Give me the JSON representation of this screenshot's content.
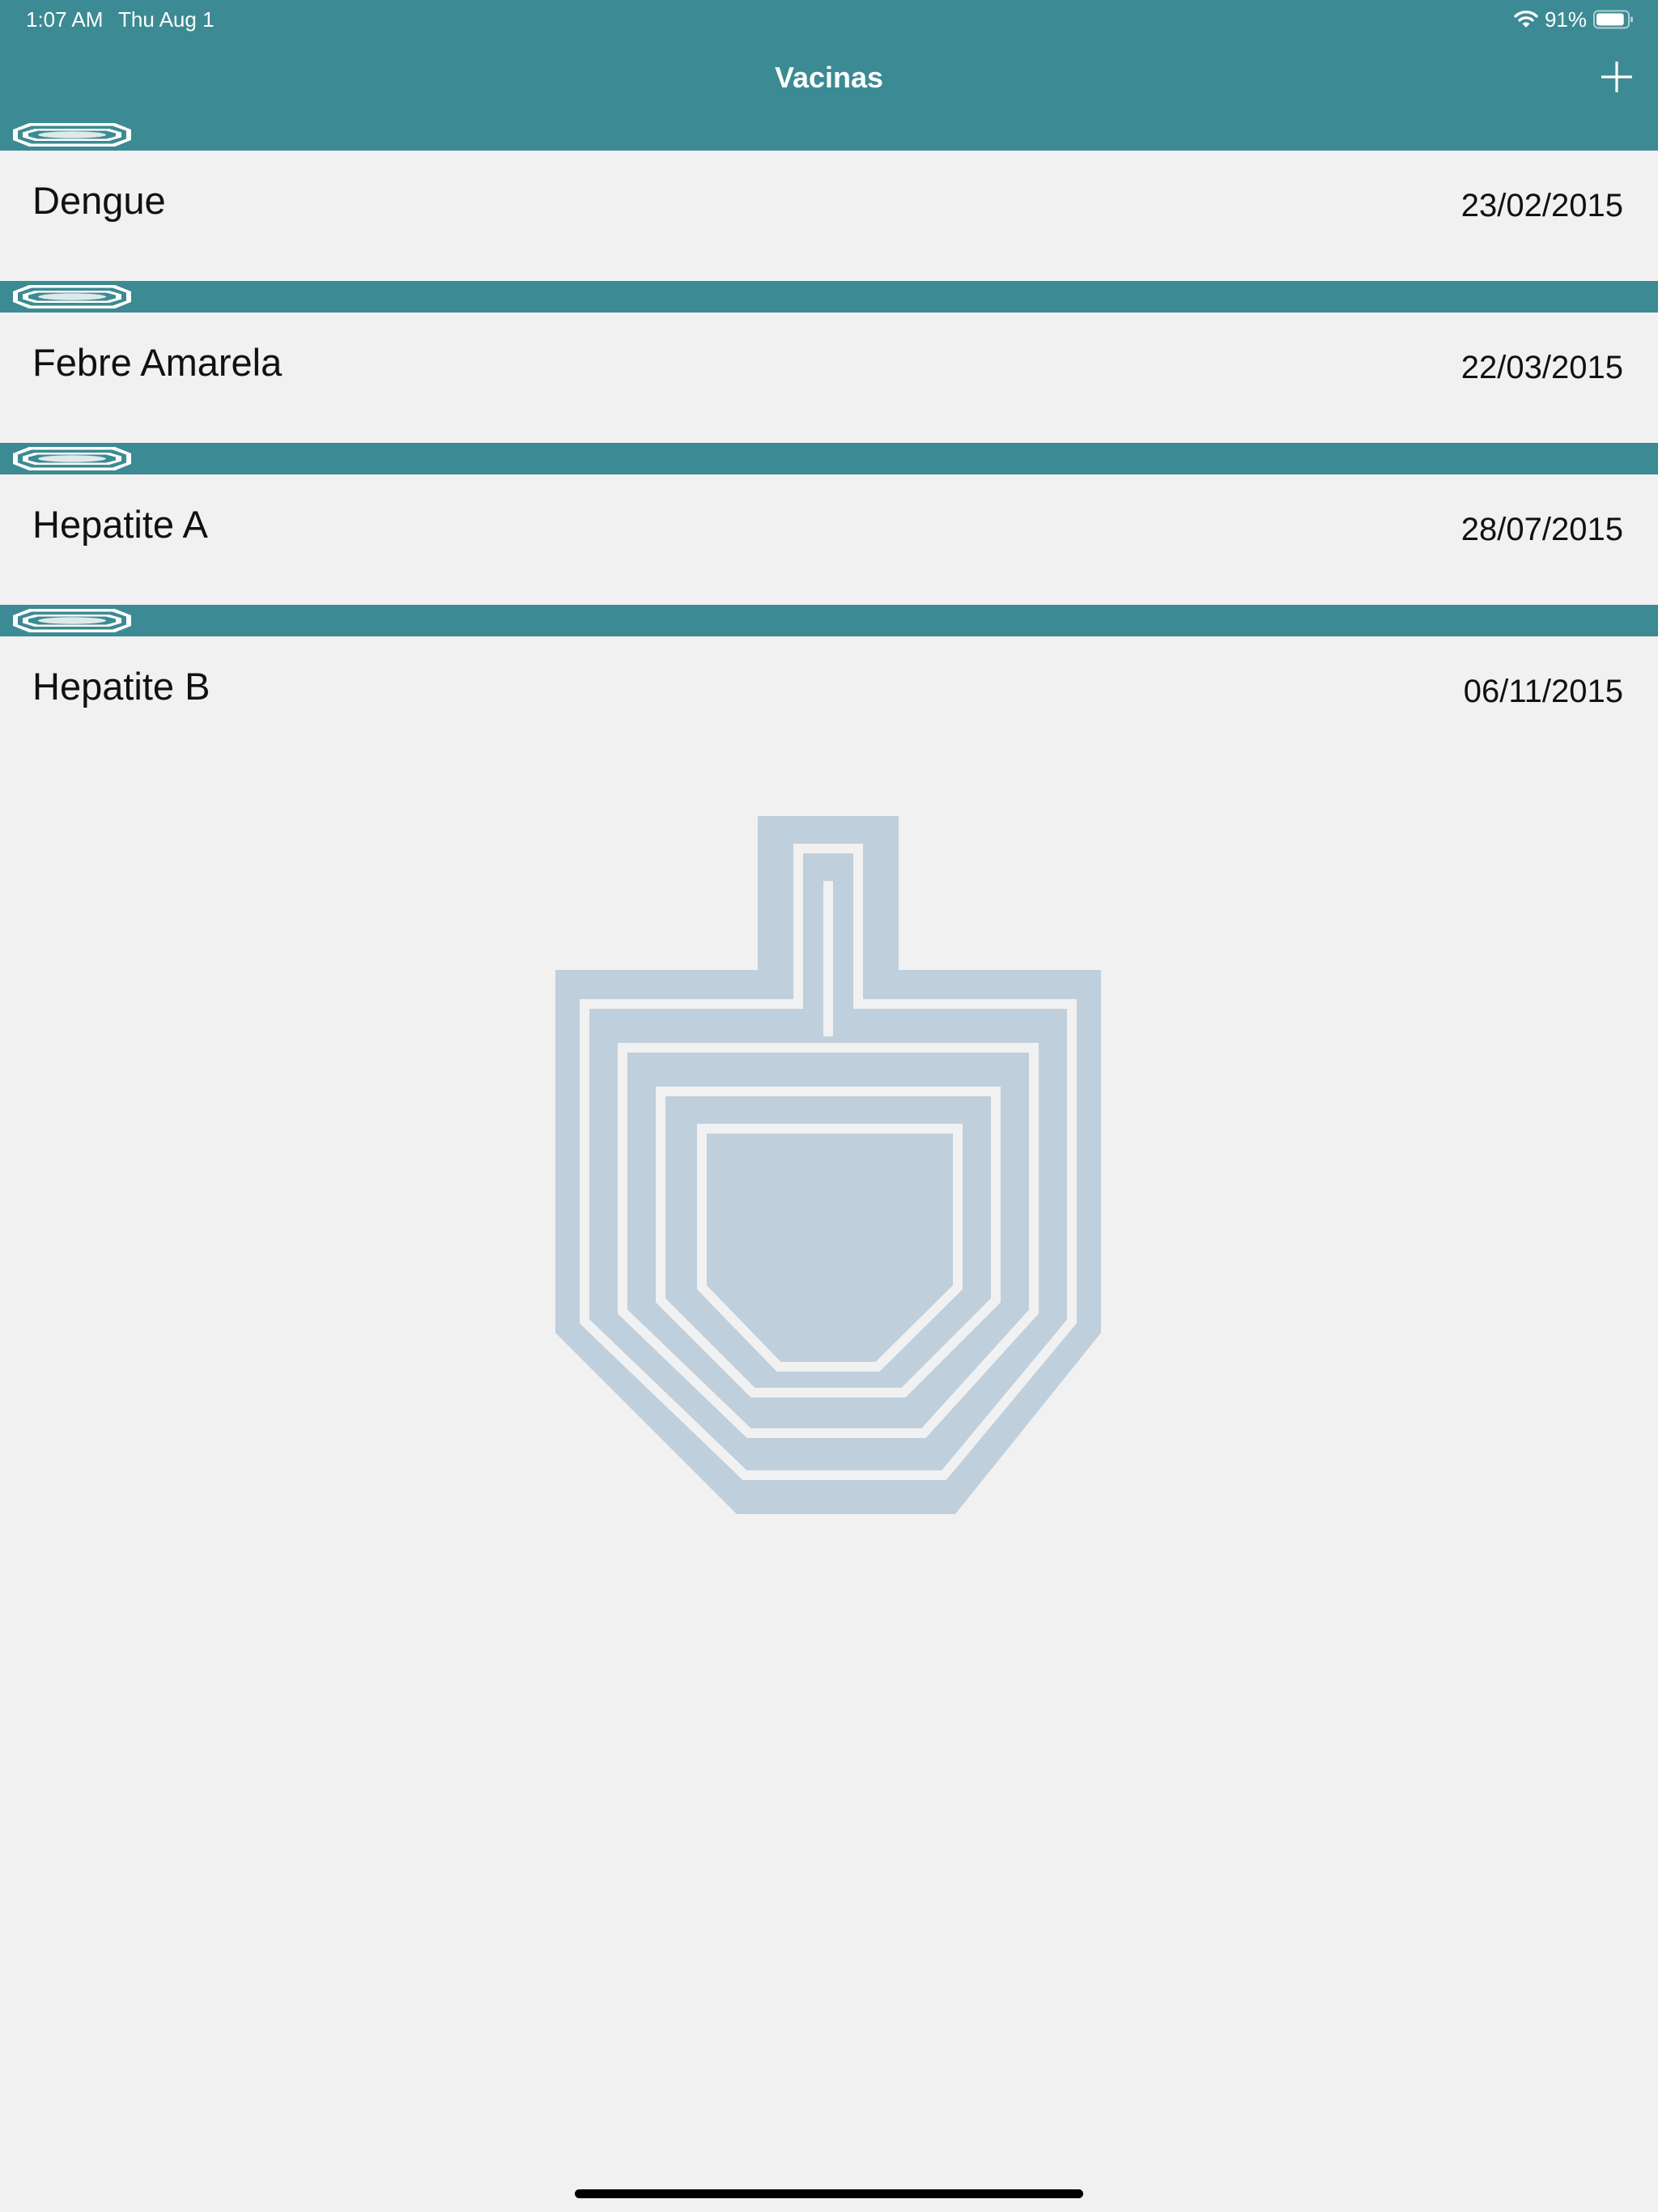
{
  "status_bar": {
    "time": "1:07 AM",
    "date": "Thu Aug 1",
    "battery": "91%",
    "battery_level": 0.91,
    "wifi_icon": "wifi-icon",
    "battery_icon": "battery-icon"
  },
  "nav": {
    "title": "Vacinas",
    "add_icon": "plus-icon"
  },
  "vaccines": [
    {
      "name": "Dengue",
      "date": "23/02/2015"
    },
    {
      "name": "Febre Amarela",
      "date": "22/03/2015"
    },
    {
      "name": "Hepatite A",
      "date": "28/07/2015"
    },
    {
      "name": "Hepatite B",
      "date": "06/11/2015"
    }
  ],
  "colors": {
    "header": "#3c8a93",
    "background": "#f1f1f1",
    "watermark": "#bfcfdc",
    "text": "#111111"
  },
  "icons": {
    "row_header": "octagon-rings-icon",
    "watermark": "shield-logo-icon"
  }
}
